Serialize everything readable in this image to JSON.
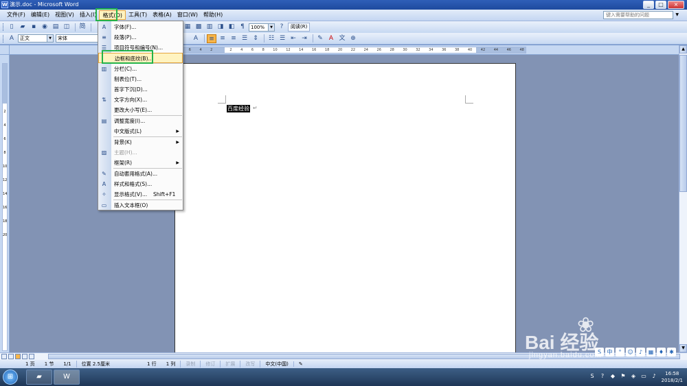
{
  "window": {
    "title": "演示.doc - Microsoft Word",
    "app_icon": "W",
    "min": "_",
    "max": "□",
    "close": "×"
  },
  "menubar": {
    "items": [
      "文件(F)",
      "编辑(E)",
      "视图(V)",
      "插入(I)",
      "格式(O)",
      "工具(T)",
      "表格(A)",
      "窗口(W)",
      "帮助(H)"
    ],
    "active": "格式(O)",
    "help_placeholder": "键入需要帮助的问题"
  },
  "toolbar1": {
    "simp_label": "简",
    "zoom": "100%",
    "read_label": "阅读(R)"
  },
  "toolbar2": {
    "style_value": "正文",
    "font_value": "宋体"
  },
  "ruler": {
    "h_ticks": [
      "8",
      "6",
      "4",
      "2",
      "",
      "2",
      "4",
      "6",
      "8",
      "10",
      "12",
      "14",
      "16",
      "18",
      "20",
      "22",
      "24",
      "26",
      "28",
      "30",
      "32",
      "34",
      "36",
      "38",
      "40",
      "42",
      "44",
      "46",
      "48"
    ],
    "v_ticks": [
      "2",
      "4",
      "6",
      "8",
      "10",
      "12",
      "14",
      "16",
      "18",
      "20"
    ]
  },
  "document": {
    "selected_text": "百度经验",
    "para_mark": "↵"
  },
  "format_menu": {
    "items": [
      {
        "label": "字体(F)...",
        "icon": "A",
        "icon_name": "font-icon",
        "enabled": true
      },
      {
        "label": "段落(P)...",
        "icon": "≡",
        "icon_name": "paragraph-icon",
        "enabled": true
      },
      {
        "label": "项目符号和编号(N)...",
        "icon": "☰",
        "icon_name": "bullets-icon",
        "enabled": true
      },
      {
        "label": "边框和底纹(B)...",
        "icon": "",
        "icon_name": "",
        "enabled": true,
        "highlight": true
      },
      {
        "label": "分栏(C)...",
        "icon": "▥",
        "icon_name": "columns-icon",
        "enabled": true
      },
      {
        "label": "制表位(T)...",
        "icon": "",
        "icon_name": "",
        "enabled": true
      },
      {
        "label": "首字下沉(D)...",
        "icon": "",
        "icon_name": "",
        "enabled": true
      },
      {
        "label": "文字方向(X)...",
        "icon": "⇅",
        "icon_name": "text-direction-icon",
        "enabled": true
      },
      {
        "label": "更改大小写(E)...",
        "icon": "",
        "icon_name": "",
        "enabled": true
      },
      {
        "label": "调整宽度(I)...",
        "icon": "▤",
        "icon_name": "fit-width-icon",
        "enabled": true
      },
      {
        "label": "中文版式(L)",
        "icon": "",
        "icon_name": "",
        "enabled": true,
        "submenu": true
      },
      {
        "label": "背景(K)",
        "icon": "",
        "icon_name": "",
        "enabled": true,
        "submenu": true
      },
      {
        "label": "主题(H)...",
        "icon": "▨",
        "icon_name": "theme-icon",
        "enabled": false
      },
      {
        "label": "框架(R)",
        "icon": "",
        "icon_name": "",
        "enabled": true,
        "submenu": true
      },
      {
        "label": "自动套用格式(A)...",
        "icon": "✎",
        "icon_name": "autoformat-icon",
        "enabled": true
      },
      {
        "label": "样式和格式(S)...",
        "icon": "A",
        "icon_name": "styles-icon",
        "enabled": true
      },
      {
        "label": "显示格式(V)...",
        "icon": "✧",
        "icon_name": "reveal-format-icon",
        "enabled": true,
        "shortcut": "Shift+F1"
      },
      {
        "label": "插入文本框(O)",
        "icon": "▭",
        "icon_name": "textbox-icon",
        "enabled": true
      }
    ]
  },
  "statusbar": {
    "page": "1 页",
    "section": "1 节",
    "pages": "1/1",
    "position": "位置 2.5厘米",
    "line": "1 行",
    "col": "1 列",
    "rec": "录制",
    "trk": "修订",
    "ext": "扩展",
    "ovr": "改写",
    "lang": "中文(中国)"
  },
  "watermark": {
    "brand": "Bai 经验",
    "paw": "❀",
    "url": "jingyan.baidu.com"
  },
  "clock": {
    "time": "16:58",
    "date": "2018/2/1"
  },
  "colors": {
    "highlight": "#fff3c0",
    "annotation": "#22b34a",
    "title": "#1e4a9e"
  }
}
